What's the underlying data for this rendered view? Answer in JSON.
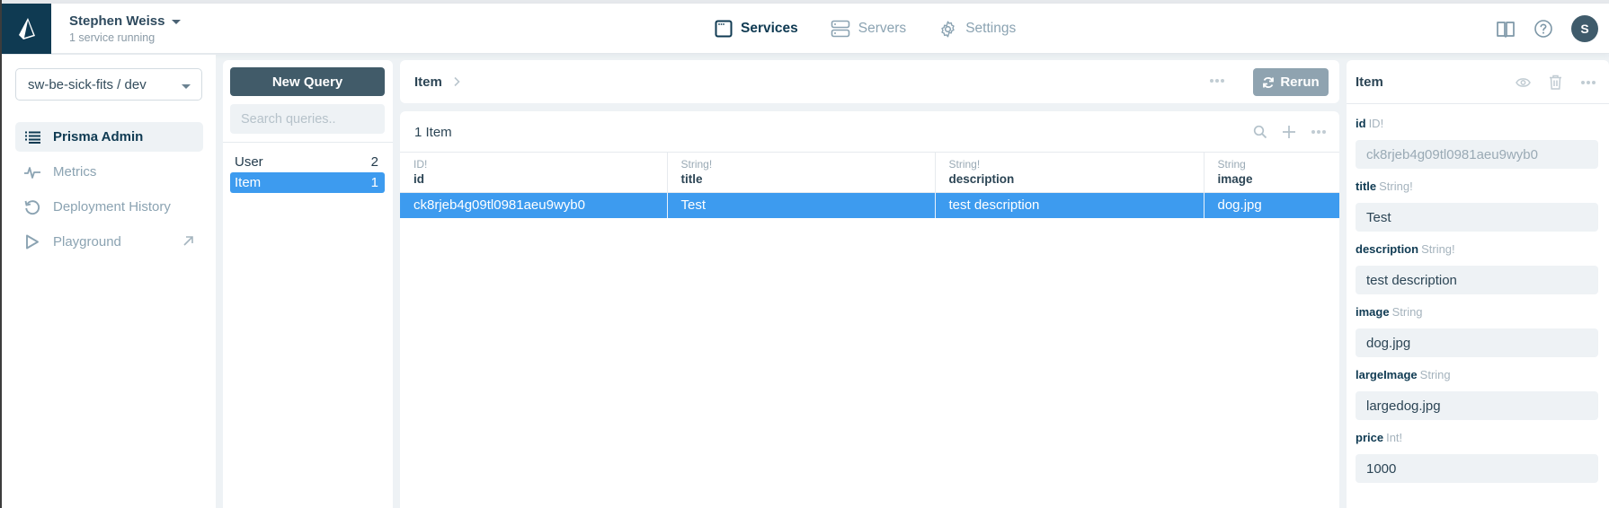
{
  "header": {
    "user_name": "Stephen Weiss",
    "user_status": "1 service running",
    "nav": [
      {
        "label": "Services",
        "icon": "browser-window-icon",
        "active": true
      },
      {
        "label": "Servers",
        "icon": "server-icon",
        "active": false
      },
      {
        "label": "Settings",
        "icon": "gear-icon",
        "active": false
      }
    ],
    "right_icons": [
      "book-icon",
      "help-icon"
    ],
    "avatar_initial": "S"
  },
  "sidebar": {
    "stage_selector": "sw-be-sick-fits / dev",
    "items": [
      {
        "label": "Prisma Admin",
        "icon": "list-icon",
        "active": true
      },
      {
        "label": "Metrics",
        "icon": "pulse-icon",
        "active": false
      },
      {
        "label": "Deployment History",
        "icon": "history-icon",
        "active": false
      },
      {
        "label": "Playground",
        "icon": "play-icon",
        "active": false,
        "external": true
      }
    ]
  },
  "queries": {
    "new_query_label": "New Query",
    "search_placeholder": "Search queries..",
    "models": [
      {
        "name": "User",
        "count": "2",
        "active": false
      },
      {
        "name": "Item",
        "count": "1",
        "active": true
      }
    ]
  },
  "query_bar": {
    "title": "Item",
    "rerun_label": "Rerun"
  },
  "results": {
    "count_label": "1 Item",
    "columns": [
      {
        "type": "ID!",
        "name": "id"
      },
      {
        "type": "String!",
        "name": "title"
      },
      {
        "type": "String!",
        "name": "description"
      },
      {
        "type": "String",
        "name": "image"
      }
    ],
    "rows": [
      [
        "ck8rjeb4g09tl0981aeu9wyb0",
        "Test",
        "test description",
        "dog.jpg"
      ]
    ]
  },
  "detail": {
    "title": "Item",
    "fields": [
      {
        "name": "id",
        "type": "ID!",
        "value": "ck8rjeb4g09tl0981aeu9wyb0",
        "readonly": true
      },
      {
        "name": "title",
        "type": "String!",
        "value": "Test"
      },
      {
        "name": "description",
        "type": "String!",
        "value": "test description"
      },
      {
        "name": "image",
        "type": "String",
        "value": "dog.jpg"
      },
      {
        "name": "largeImage",
        "type": "String",
        "value": "largedog.jpg"
      },
      {
        "name": "price",
        "type": "Int!",
        "value": "1000"
      }
    ]
  },
  "colors": {
    "brand_dark": "#0f3a52",
    "selection_blue": "#3d9bef",
    "button_dark": "#415b69",
    "rerun_gray": "#8fa3b0"
  }
}
